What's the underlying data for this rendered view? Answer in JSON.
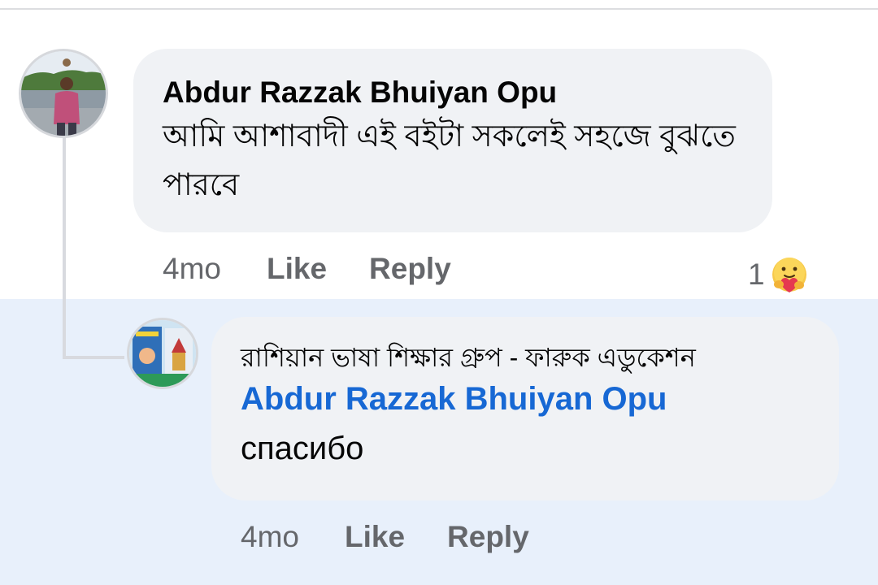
{
  "main_comment": {
    "author": "Abdur Razzak Bhuiyan Opu",
    "text": "আমি আশাবাদী এই বইটা সকলেই সহজে বুঝতে পারবে",
    "time": "4mo",
    "like_label": "Like",
    "reply_label": "Reply",
    "reaction_count": "1",
    "reaction_icon": "care-hug-emoji-icon"
  },
  "reply_comment": {
    "author": "রাশিয়ান ভাষা শিক্ষার গ্রুপ - ফারুক এডুকেশন",
    "mention": "Abdur Razzak Bhuiyan Opu",
    "text": "спасибо",
    "time": "4mo",
    "like_label": "Like",
    "reply_label": "Reply"
  },
  "colors": {
    "bubble": "#f0f2f5",
    "highlight": "#e8f0fb",
    "mention": "#1768d4",
    "meta": "#65676b"
  }
}
